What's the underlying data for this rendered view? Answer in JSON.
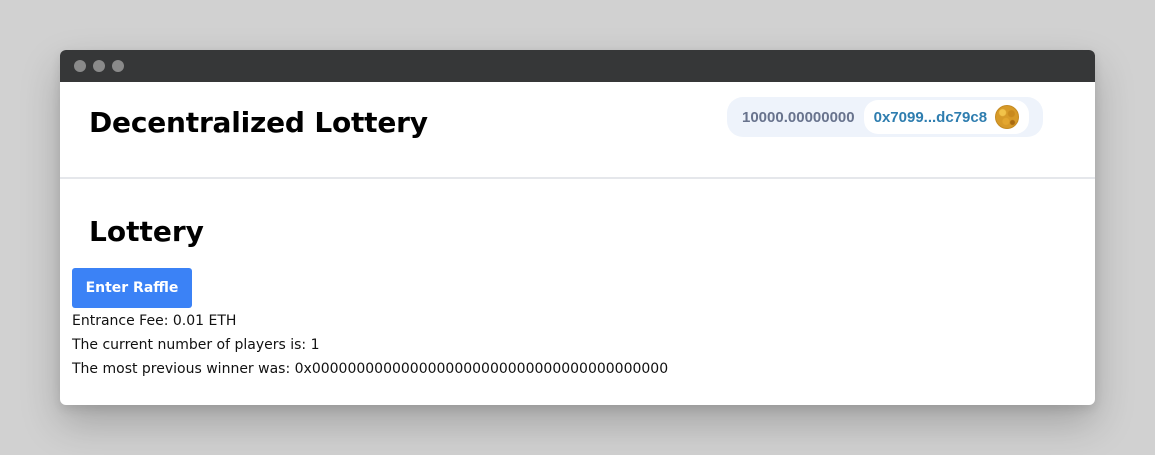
{
  "app": {
    "title": "Decentralized Lottery"
  },
  "wallet": {
    "balance": "10000.00000000",
    "address": "0x7099...dc79c8"
  },
  "lottery": {
    "heading": "Lottery",
    "enter_button_label": "Enter Raffle",
    "entrance_fee_text": "Entrance Fee: 0.01 ETH",
    "players_text": "The current number of players is: 1",
    "previous_winner_text": "The most previous winner was: 0x0000000000000000000000000000000000000000"
  },
  "colors": {
    "titlebar": "#363738",
    "button": "#3b82f6",
    "address_text": "#2e7daf",
    "balance_text": "#68738d",
    "wallet_background": "#eef3fb"
  },
  "icons": {
    "window_controls": [
      "window-dot-icon",
      "window-dot-icon",
      "window-dot-icon"
    ],
    "avatar": "wallet-avatar-icon"
  }
}
